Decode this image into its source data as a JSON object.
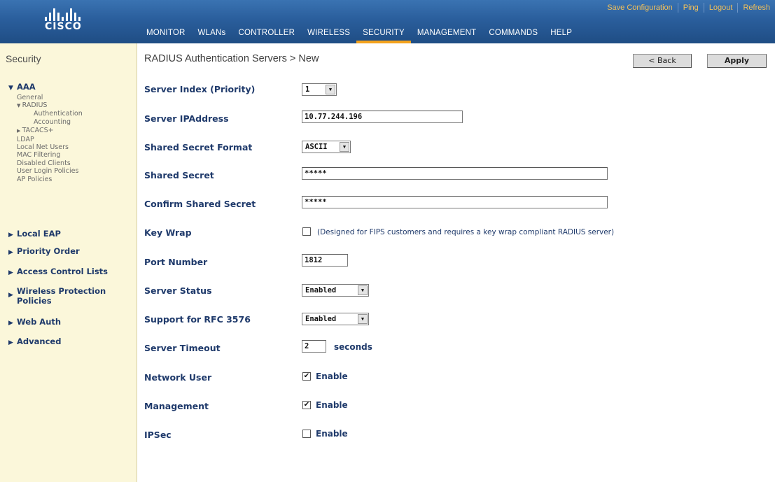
{
  "header": {
    "brand": "CISCO",
    "util_links": [
      "Save Configuration",
      "Ping",
      "Logout",
      "Refresh"
    ],
    "nav": [
      "MONITOR",
      "WLANs",
      "CONTROLLER",
      "WIRELESS",
      "SECURITY",
      "MANAGEMENT",
      "COMMANDS",
      "HELP"
    ],
    "active_nav": "SECURITY"
  },
  "sidebar": {
    "title": "Security",
    "aaa": "AAA",
    "aaa_items": {
      "general": "General",
      "radius": "RADIUS",
      "authentication": "Authentication",
      "accounting": "Accounting",
      "tacacs": "TACACS+",
      "ldap": "LDAP",
      "local_net_users": "Local Net Users",
      "mac_filtering": "MAC Filtering",
      "disabled_clients": "Disabled Clients",
      "user_login_policies": "User Login Policies",
      "ap_policies": "AP Policies"
    },
    "local_eap": "Local EAP",
    "priority_order": "Priority Order",
    "acl": "Access Control Lists",
    "wpp_line1": "Wireless Protection",
    "wpp_line2": "Policies",
    "web_auth": "Web Auth",
    "advanced": "Advanced"
  },
  "page": {
    "title": "RADIUS Authentication Servers > New",
    "back_label": "< Back",
    "apply_label": "Apply"
  },
  "form": {
    "server_index": {
      "label": "Server Index (Priority)",
      "value": "1"
    },
    "server_ip": {
      "label": "Server IPAddress",
      "value": "10.77.244.196"
    },
    "secret_format": {
      "label": "Shared Secret Format",
      "value": "ASCII"
    },
    "shared_secret": {
      "label": "Shared Secret",
      "value": "*****"
    },
    "confirm_secret": {
      "label": "Confirm Shared Secret",
      "value": "*****"
    },
    "key_wrap": {
      "label": "Key Wrap",
      "checked": false,
      "note": "(Designed for FIPS customers and requires a key wrap compliant RADIUS server)"
    },
    "port": {
      "label": "Port Number",
      "value": "1812"
    },
    "server_status": {
      "label": "Server Status",
      "value": "Enabled"
    },
    "rfc3576": {
      "label": "Support for RFC 3576",
      "value": "Enabled"
    },
    "timeout": {
      "label": "Server Timeout",
      "value": "2",
      "unit": "seconds"
    },
    "network_user": {
      "label": "Network User",
      "checked": true,
      "text": "Enable"
    },
    "management": {
      "label": "Management",
      "checked": true,
      "text": "Enable"
    },
    "ipsec": {
      "label": "IPSec",
      "checked": false,
      "text": "Enable"
    }
  },
  "colors": {
    "header_blue": "#2a5e9c",
    "nav_active_underline": "#f3a21c",
    "util_link": "#f3c15a",
    "sidebar_bg": "#fbf7da",
    "label_navy": "#1f3a6b"
  }
}
